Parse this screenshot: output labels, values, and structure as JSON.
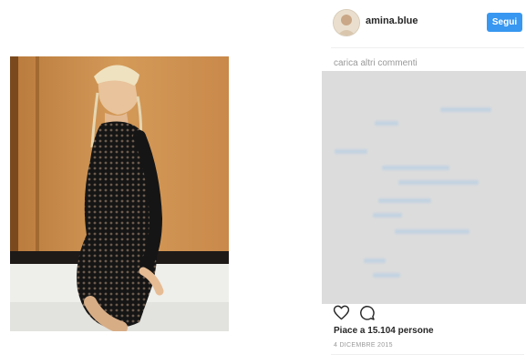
{
  "post": {
    "username": "amina.blue",
    "follow_label": "Segui",
    "load_more_label": "carica altri commenti",
    "likes_text": "Piace a 15.104 persone",
    "date_text": "4 DICEMBRE 2015"
  },
  "icons": {
    "like": "heart-icon",
    "comment": "comment-icon"
  },
  "colors": {
    "accent": "#3897f0",
    "muted_text": "#999999",
    "comments_placeholder": "#dcdcdc",
    "photo_background": "#c98c48"
  }
}
